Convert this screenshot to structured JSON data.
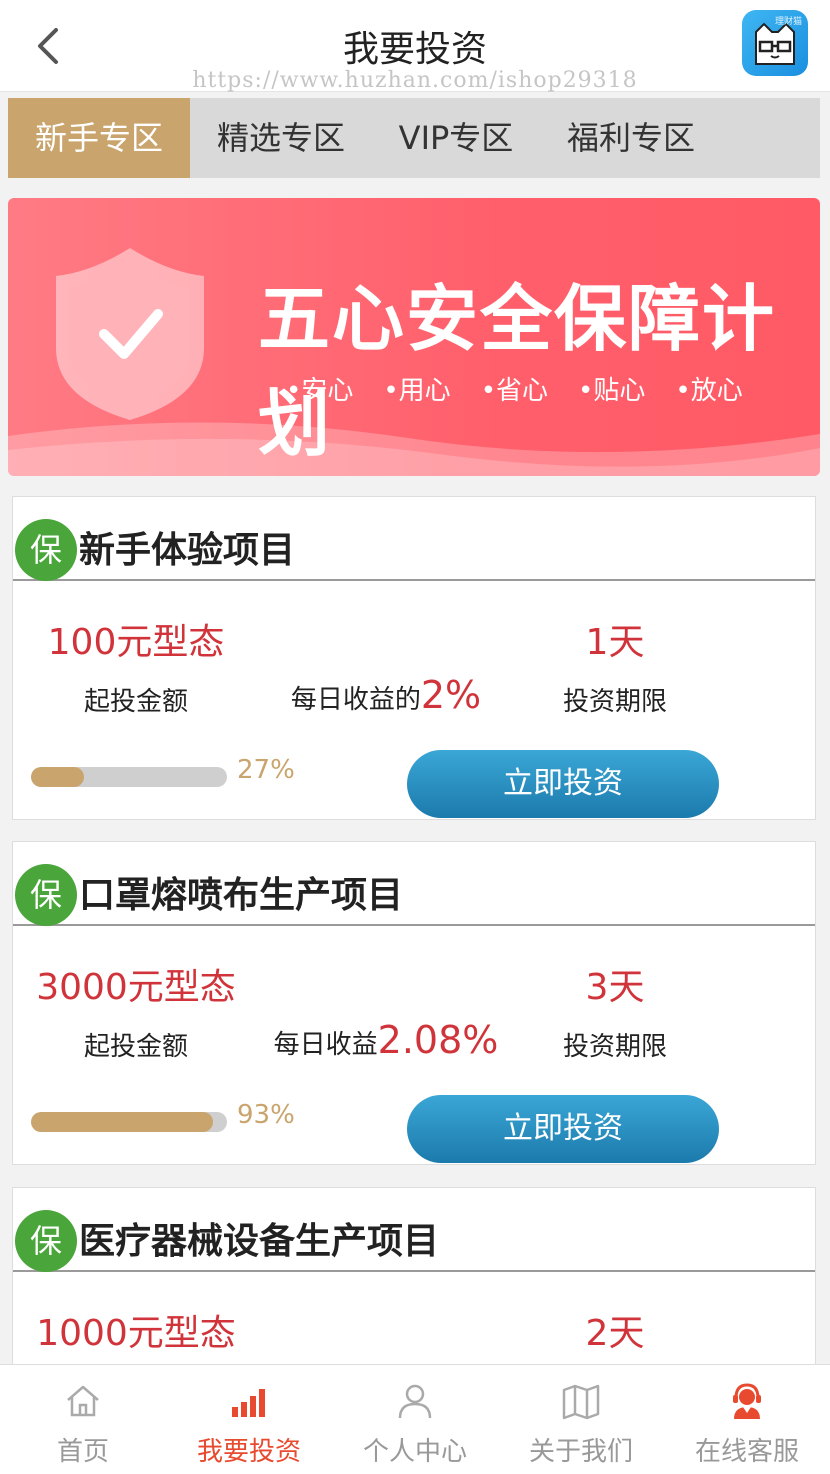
{
  "header": {
    "title": "我要投资",
    "watermark": "https://www.huzhan.com/ishop29318",
    "logo_text": "理财猫"
  },
  "tabs": [
    {
      "label": "新手专区",
      "active": true
    },
    {
      "label": "精选专区",
      "active": false
    },
    {
      "label": "VIP专区",
      "active": false
    },
    {
      "label": "福利专区",
      "active": false
    }
  ],
  "banner": {
    "title": "五心安全保障计划",
    "items": [
      "•安心",
      "•用心",
      "•省心",
      "•贴心",
      "•放心"
    ]
  },
  "products": [
    {
      "badge": "保",
      "title": "新手体验项目",
      "amount": "100元型态",
      "amount_label": "起投金额",
      "yield_prefix": "每日收益的",
      "yield_rate": "2%",
      "days": "1天",
      "days_label": "投资期限",
      "progress_text": "27%",
      "progress": 0.27,
      "button": "立即投资"
    },
    {
      "badge": "保",
      "title": "口罩熔喷布生产项目",
      "amount": "3000元型态",
      "amount_label": "起投金额",
      "yield_prefix": "每日收益",
      "yield_rate": "2.08%",
      "days": "3天",
      "days_label": "投资期限",
      "progress_text": "93%",
      "progress": 0.93,
      "button": "立即投资"
    },
    {
      "badge": "保",
      "title": "医疗器械设备生产项目",
      "amount": "1000元型态",
      "days": "2天"
    }
  ],
  "bottom_nav": [
    {
      "label": "首页",
      "icon": "home-icon",
      "active": false
    },
    {
      "label": "我要投资",
      "icon": "bar-chart-icon",
      "active": true
    },
    {
      "label": "个人中心",
      "icon": "user-icon",
      "active": false
    },
    {
      "label": "关于我们",
      "icon": "map-icon",
      "active": false
    },
    {
      "label": "在线客服",
      "icon": "customer-service-icon",
      "active": false
    }
  ],
  "colors": {
    "accent_gold": "#c9a46c",
    "accent_red": "#d0343a",
    "button_blue": "#1c7aac",
    "nav_active": "#e84a2f",
    "badge_green": "#4aa53a"
  }
}
